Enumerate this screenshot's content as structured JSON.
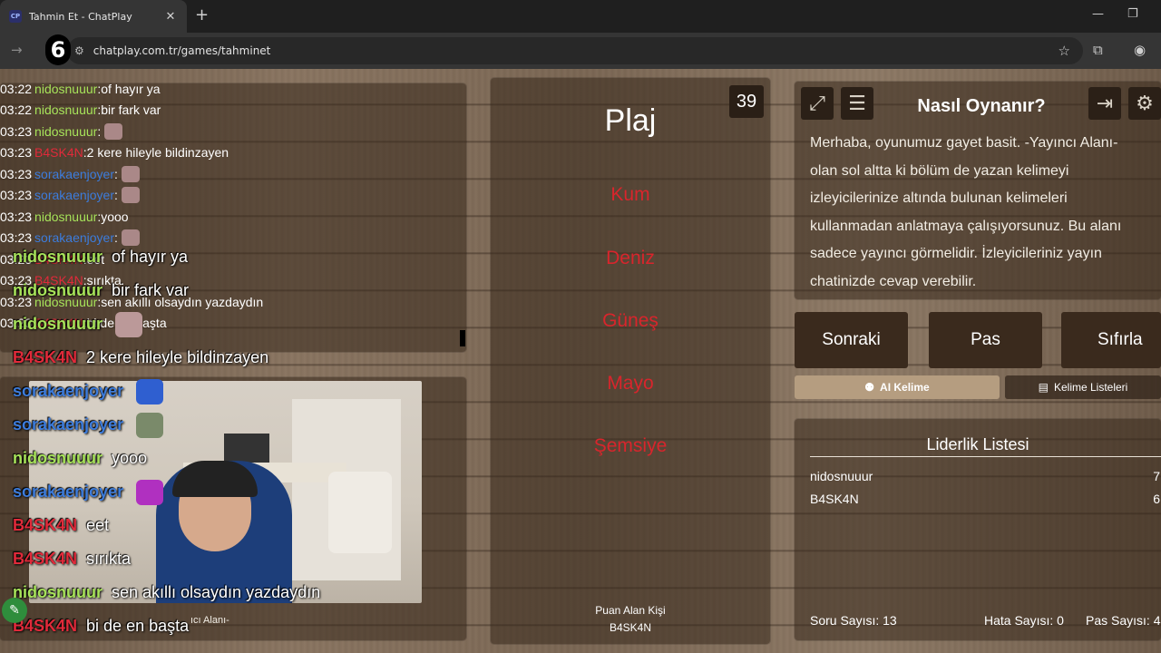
{
  "browser": {
    "tab_title": "Tahmin Et - ChatPlay",
    "favicon": "CP",
    "url": "chatplay.com.tr/games/tahminet",
    "overlay_number": "6"
  },
  "chat_small": [
    {
      "time": "03:22",
      "user": "nidosnuuur",
      "color": "#a7e35a",
      "msg": "of hayır ya"
    },
    {
      "time": "03:22",
      "user": "nidosnuuur",
      "color": "#a7e35a",
      "msg": "bir fark var"
    },
    {
      "time": "03:23",
      "user": "nidosnuuur",
      "color": "#a7e35a",
      "msg": "",
      "emote": true
    },
    {
      "time": "03:23",
      "user": "B4SK4N",
      "color": "#e02a3a",
      "msg": "2 kere hileyle bildinzayen"
    },
    {
      "time": "03:23",
      "user": "sorakaenjoyer",
      "color": "#3c7cdc",
      "msg": "",
      "emote": true
    },
    {
      "time": "03:23",
      "user": "sorakaenjoyer",
      "color": "#3c7cdc",
      "msg": "",
      "emote": true
    },
    {
      "time": "03:23",
      "user": "nidosnuuur",
      "color": "#a7e35a",
      "msg": "yooo"
    },
    {
      "time": "03:23",
      "user": "sorakaenjoyer",
      "color": "#3c7cdc",
      "msg": "",
      "emote": true
    },
    {
      "time": "03:23",
      "user": "B4SK4N",
      "color": "#e02a3a",
      "msg": "eet"
    },
    {
      "time": "03:23",
      "user": "B4SK4N",
      "color": "#e02a3a",
      "msg": "sırıkta"
    },
    {
      "time": "03:23",
      "user": "nidosnuuur",
      "color": "#a7e35a",
      "msg": "sen akıllı olsaydın yazdaydın"
    },
    {
      "time": "03:23",
      "user": "B4SK4N",
      "color": "#e02a3a",
      "msg": "bi de en başta"
    }
  ],
  "chat_big": [
    {
      "user": "nidosnuuur",
      "color": "#a7e35a",
      "msg": "of hayır ya"
    },
    {
      "user": "nidosnuuur",
      "color": "#a7e35a",
      "msg": "bir fark var"
    },
    {
      "user": "nidosnuuur",
      "color": "#a7e35a",
      "msg": "",
      "emote": "#b99"
    },
    {
      "user": "B4SK4N",
      "color": "#e02a3a",
      "msg": "2 kere hileyle bildinzayen"
    },
    {
      "user": "sorakaenjoyer",
      "color": "#3c7cdc",
      "msg": "",
      "emote": "#2f5fd0"
    },
    {
      "user": "sorakaenjoyer",
      "color": "#3c7cdc",
      "msg": "",
      "emote": "#7a8a6a"
    },
    {
      "user": "nidosnuuur",
      "color": "#a7e35a",
      "msg": "yooo"
    },
    {
      "user": "sorakaenjoyer",
      "color": "#3c7cdc",
      "msg": "",
      "emote": "#b030c0"
    },
    {
      "user": "B4SK4N",
      "color": "#e02a3a",
      "msg": "eet"
    },
    {
      "user": "B4SK4N",
      "color": "#e02a3a",
      "msg": "sırıkta"
    },
    {
      "user": "nidosnuuur",
      "color": "#a7e35a",
      "msg": "sen akıllı olsaydın yazdaydın"
    },
    {
      "user": "B4SK4N",
      "color": "#e02a3a",
      "msg": "bi de en başta"
    }
  ],
  "stream_label": "ıcı Alanı-",
  "game": {
    "timer": "39",
    "word": "Plaj",
    "taboo_words": [
      "Kum",
      "Deniz",
      "Güneş",
      "Mayo",
      "Şemsiye"
    ],
    "scorer_label": "Puan Alan Kişi",
    "scorer_name": "B4SK4N"
  },
  "howto": {
    "title": "Nasıl Oynanır?",
    "lines": [
      "Merhaba, oyunumuz gayet basit. -Yayıncı Alanı-",
      "olan sol altta ki bölüm de yazan kelimeyi",
      "izleyicilerinize altında bulunan kelimeleri",
      "kullanmadan anlatmaya çalışıyorsunuz. Bu alanı",
      "sadece yayıncı görmelidir. İzleyicileriniz yayın",
      "chatinizde cevap verebilir."
    ]
  },
  "buttons": {
    "next": "Sonraki",
    "pass": "Pas",
    "reset": "Sıfırla"
  },
  "subtabs": {
    "ai_word": "AI Kelime",
    "word_lists": "Kelime Listeleri"
  },
  "leaderboard": {
    "title": "Liderlik Listesi",
    "rows": [
      {
        "name": "nidosnuuur",
        "score": "7"
      },
      {
        "name": "B4SK4N",
        "score": "6"
      }
    ]
  },
  "stats": {
    "questions": "Soru Sayısı: 13",
    "errors": "Hata Sayısı: 0",
    "passes": "Pas Sayısı: 4"
  },
  "icons": {
    "expand": "expand-icon",
    "document": "document-icon",
    "exit": "exit-icon",
    "settings": "gear-icon"
  }
}
